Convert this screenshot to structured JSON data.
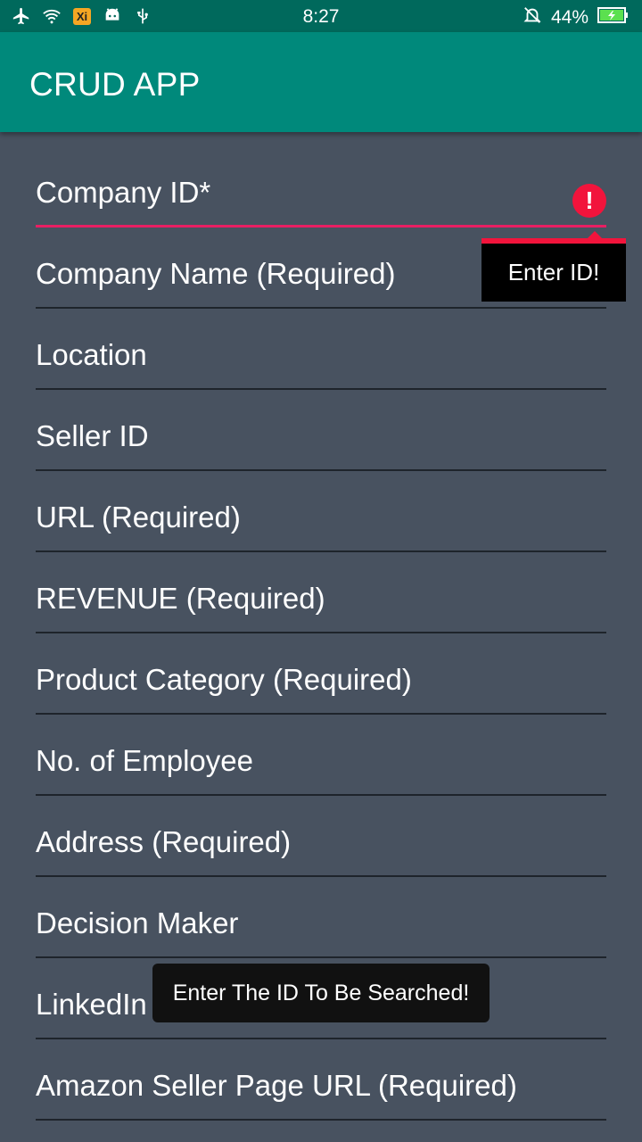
{
  "status_bar": {
    "time": "8:27",
    "battery_percent": "44%",
    "notification_badge": "Xi",
    "icons": [
      "airplane-icon",
      "wifi-icon",
      "app-notification-icon",
      "android-icon",
      "usb-icon",
      "bell-off-icon",
      "battery-icon"
    ]
  },
  "app_bar": {
    "title": "CRUD APP",
    "color": "#00897b"
  },
  "form": {
    "fields": [
      {
        "label": "Company ID*"
      },
      {
        "label": "Company Name (Required)"
      },
      {
        "label": "Location"
      },
      {
        "label": "Seller ID"
      },
      {
        "label": "URL (Required)"
      },
      {
        "label": "REVENUE (Required)"
      },
      {
        "label": "Product Category (Required)"
      },
      {
        "label": "No. of Employee"
      },
      {
        "label": "Address (Required)"
      },
      {
        "label": "Decision Maker"
      },
      {
        "label": "LinkedIn URL(If any)"
      },
      {
        "label": "Amazon Seller Page URL (Required)"
      }
    ],
    "error_icon_text": "!",
    "error_message": "Enter ID!",
    "error_color": "#f2143c"
  },
  "toast": {
    "message": "Enter The ID To Be Searched!"
  }
}
